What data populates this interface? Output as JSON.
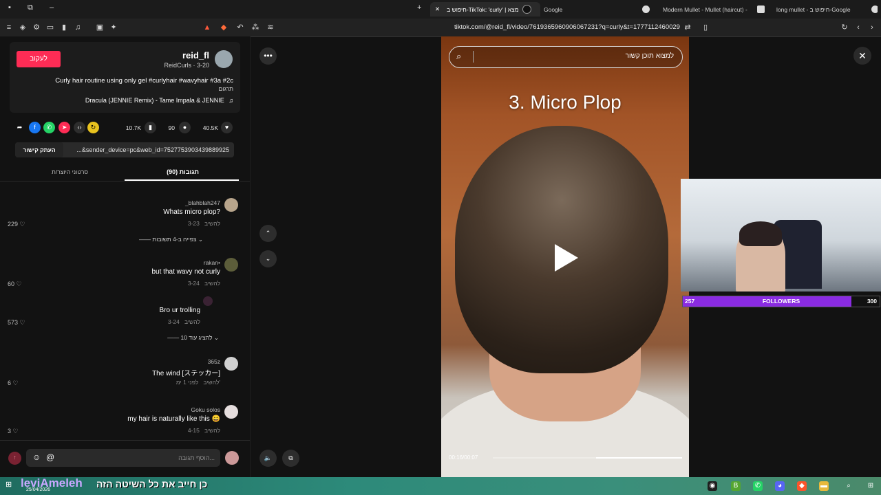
{
  "tabs": [
    {
      "label": "חיפוש ב-TikTok: 'curly' | מצא",
      "active": true
    },
    {
      "label": "Google"
    },
    {
      "label": "Modern Mullet - Mullet (haircut) - W"
    },
    {
      "label": "long mullet - חיפוש ב-Google"
    }
  ],
  "toolbar": {
    "url": "tiktok.com/@reid_fl/video/7619365960906067231?q=curly&t=1777112460029"
  },
  "author": {
    "username": "reid_fl",
    "subline": "ReidCurls · 3-20",
    "follow_label": "לעקוב",
    "caption": "Curly hair routine using only gel #curlyhair #wavyhair #3a #2c",
    "translate": "תרגום",
    "music": "Dracula (JENNIE Remix) - Tame Impala & JENNIE"
  },
  "stats": {
    "likes": "40.5K",
    "comments": "90",
    "saves": "10.7K"
  },
  "share": {
    "link": "...&sender_device=pc&web_id=7527753903439889925",
    "copy_label": "העתק קישור"
  },
  "panel_tabs": {
    "comments": "תגובות (90)",
    "creator_videos": "סרטוני היוצר/ת"
  },
  "comments": [
    {
      "user": "_blahblah247",
      "text": "Whats micro plop?",
      "date": "3-23",
      "reply": "להשיב",
      "likes": "229"
    },
    {
      "user": "rakan•",
      "text": "but that wavy not curly",
      "date": "3-24",
      "reply": "להשיב",
      "likes": "60"
    },
    {
      "user": "",
      "text": "Bro ur trolling",
      "date": "3-24",
      "reply": "להשיב",
      "likes": "573"
    },
    {
      "user": "365z",
      "text": "The wind [ステッカー]",
      "date": "לפני 1 ימ'",
      "reply": "להשיב",
      "likes": "6"
    },
    {
      "user": "Goku solos",
      "text": "my hair is naturally like this 😄",
      "date": "4-15",
      "reply": "להשיב",
      "likes": "3"
    }
  ],
  "replies_toggle": {
    "view": "צפייה ב-4 תשובות",
    "more": "להציג עוד 10"
  },
  "comment_input": {
    "placeholder": "הוסף תגובה..."
  },
  "video": {
    "search_placeholder": "למצוא תוכן קשור",
    "overlay_title": "3. Micro Plop",
    "time": "00:16/00:07"
  },
  "stream": {
    "followers_current": "257",
    "followers_label": "FOLLOWERS",
    "followers_goal": "300",
    "followers_progress": 0.8567,
    "ticker": "כן חייב את כל השיטה הזה",
    "streamer": "leviAmeleh",
    "date": "25/04/2026"
  },
  "colors": {
    "accent": "#fe2c55",
    "bar": "#8a2be2"
  }
}
